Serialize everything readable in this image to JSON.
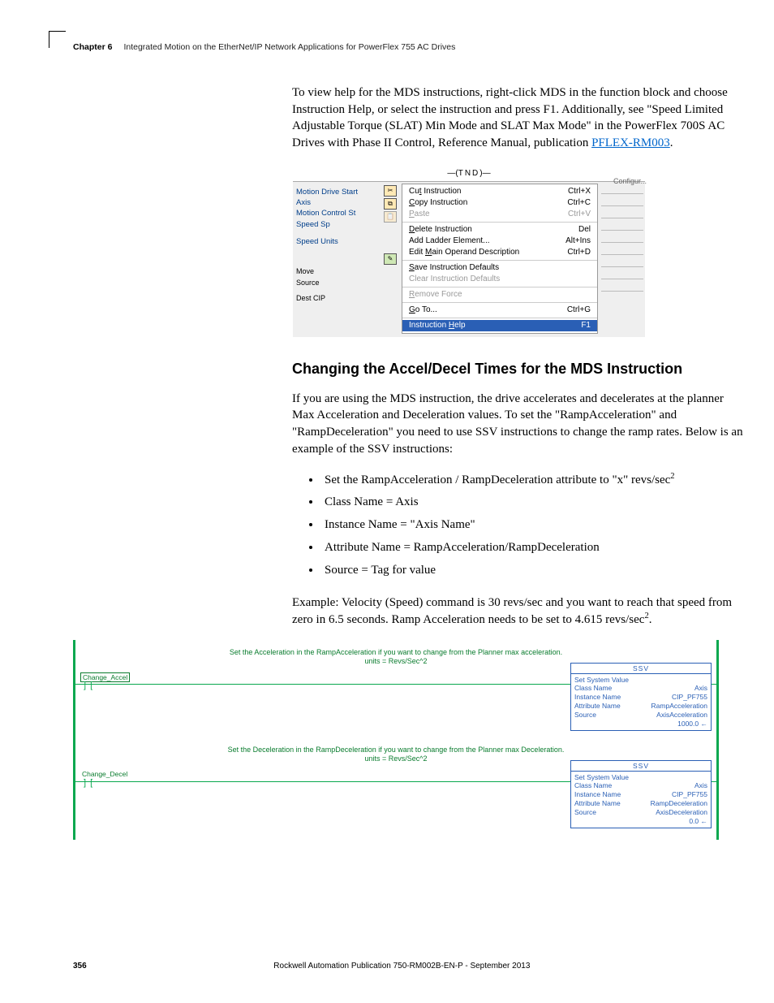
{
  "header": {
    "chapter_label": "Chapter 6",
    "chapter_title": "Integrated Motion on the EtherNet/IP Network Applications for PowerFlex 755 AC Drives"
  },
  "intro_para_pre": "To view help for the MDS instructions, right-click MDS in the function block and choose Instruction Help, or select the instruction and press F1. Additionally, see \"Speed Limited Adjustable Torque (SLAT) Min Mode and SLAT Max Mode\" in the PowerFlex 700S AC Drives with Phase II Control, Reference Manual, publication ",
  "intro_link": "PFLEX-RM003",
  "intro_post": ".",
  "screenshot": {
    "tnd": "TND",
    "left": {
      "l1": "Motion Drive Start",
      "l2": "Axis",
      "l3": "Motion Control   St",
      "l4": "Speed              Sp",
      "l5": "Speed Units",
      "box1": "Move",
      "box2": "Source",
      "box3": "Dest   CIP"
    },
    "configur": "Configur...",
    "menu": {
      "s1": [
        {
          "label": "Cut Instruction",
          "ul": "t",
          "sc": "Ctrl+X",
          "disabled": false
        },
        {
          "label": "Copy Instruction",
          "ul": "C",
          "sc": "Ctrl+C",
          "disabled": false
        },
        {
          "label": "Paste",
          "ul": "P",
          "sc": "Ctrl+V",
          "disabled": true
        }
      ],
      "s2": [
        {
          "label": "Delete Instruction",
          "ul": "D",
          "sc": "Del",
          "disabled": false
        },
        {
          "label": "Add Ladder Element...",
          "ul": "",
          "sc": "Alt+Ins",
          "disabled": false
        },
        {
          "label": "Edit Main Operand Description",
          "ul": "M",
          "sc": "Ctrl+D",
          "disabled": false
        }
      ],
      "s3": [
        {
          "label": "Save Instruction Defaults",
          "ul": "S",
          "sc": "",
          "disabled": false
        },
        {
          "label": "Clear Instruction Defaults",
          "ul": "",
          "sc": "",
          "disabled": true
        }
      ],
      "s4": [
        {
          "label": "Remove Force",
          "ul": "R",
          "sc": "",
          "disabled": true
        }
      ],
      "s5": [
        {
          "label": "Go To...",
          "ul": "G",
          "sc": "Ctrl+G",
          "disabled": false
        }
      ],
      "s6": [
        {
          "label": "Instruction Help",
          "ul": "H",
          "sc": "F1",
          "disabled": false,
          "hl": true
        }
      ]
    }
  },
  "h2": "Changing the Accel/Decel Times for the MDS Instruction",
  "para2": "If you are using the MDS instruction, the drive accelerates and decelerates at the planner Max Acceleration and Deceleration values. To set the \"RampAcceleration\" and \"RampDeceleration\" you need to use SSV instructions to change the ramp rates. Below is an example of the SSV instructions:",
  "bullets": {
    "b1_pre": "Set the RampAcceleration / RampDeceleration attribute to \"x\" revs/sec",
    "b1_sup": "2",
    "b2": "Class Name = Axis",
    "b3": "Instance Name = \"Axis Name\"",
    "b4": "Attribute Name = RampAcceleration/RampDeceleration",
    "b5": "Source = Tag for value"
  },
  "para3_pre": "Example: Velocity (Speed) command is 30 revs/sec and you want to reach that speed from zero in 6.5 seconds. Ramp Acceleration needs to be set to 4.615 revs/sec",
  "para3_sup": "2",
  "para3_post": ".",
  "ladder": {
    "rung1": {
      "comment_l1": "Set the Acceleration in the RampAcceleration if you want to change from the Planner max acceleration.",
      "comment_l2": "units = Revs/Sec^2",
      "tag": "Change_Accel",
      "ssv": {
        "title": "SSV",
        "l1": "Set System Value",
        "rows": [
          {
            "k": "Class Name",
            "v": "Axis"
          },
          {
            "k": "Instance Name",
            "v": "CIP_PF755"
          },
          {
            "k": "Attribute Name",
            "v": "RampAcceleration"
          },
          {
            "k": "Source",
            "v": "AxisAcceleration"
          },
          {
            "k": "",
            "v": "1000.0 ←"
          }
        ]
      }
    },
    "rung2": {
      "comment_l1": "Set the Deceleration in the RampDeceleration if you want to change from the Planner max Deceleration.",
      "comment_l2": "units = Revs/Sec^2",
      "tag": "Change_Decel",
      "ssv": {
        "title": "SSV",
        "l1": "Set System Value",
        "rows": [
          {
            "k": "Class Name",
            "v": "Axis"
          },
          {
            "k": "Instance Name",
            "v": "CIP_PF755"
          },
          {
            "k": "Attribute Name",
            "v": "RampDeceleration"
          },
          {
            "k": "Source",
            "v": "AxisDeceleration"
          },
          {
            "k": "",
            "v": "0.0 ←"
          }
        ]
      }
    }
  },
  "footer": {
    "page": "356",
    "pub": "Rockwell Automation Publication 750-RM002B-EN-P - September 2013"
  }
}
